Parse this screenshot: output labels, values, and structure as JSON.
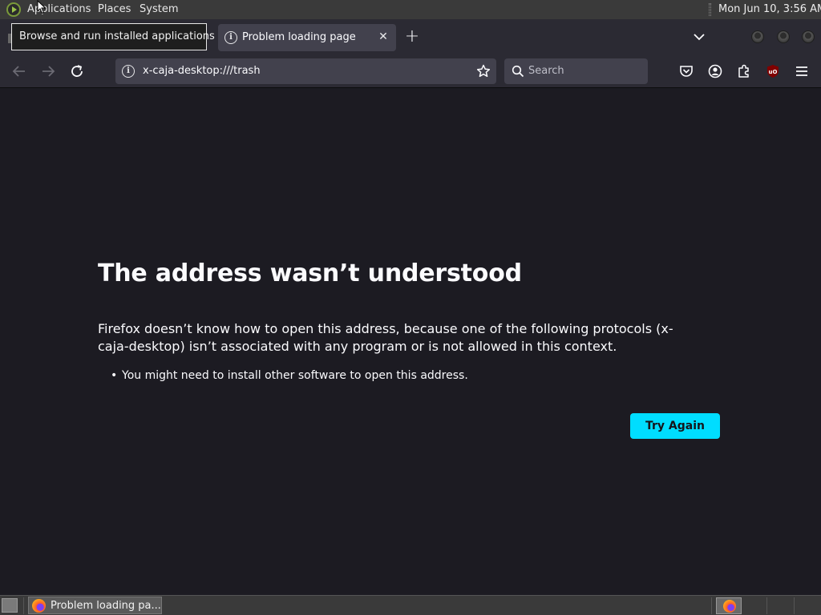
{
  "top_panel": {
    "menus": [
      "Applications",
      "Places",
      "System"
    ],
    "clock": "Mon Jun 10,  3:56 AM"
  },
  "tooltip": {
    "text": "Browse and run installed applications"
  },
  "tab": {
    "title": "Problem loading page"
  },
  "nav": {
    "url": "x-caja-desktop:///trash",
    "search_placeholder": "Search"
  },
  "page": {
    "title": "The address wasn’t understood",
    "description": "Firefox doesn’t know how to open this address, because one of the following protocols (x-caja-desktop) isn’t associated with any program or is not allowed in this context.",
    "list_item": "You might need to install other software to open this address.",
    "button": "Try Again"
  },
  "taskbar": {
    "task_label": "Problem loading pa..."
  },
  "colors": {
    "accent": "#00ddff",
    "page_bg": "#1c1b22",
    "toolbar": "#2b2a33",
    "field": "#42414d"
  }
}
